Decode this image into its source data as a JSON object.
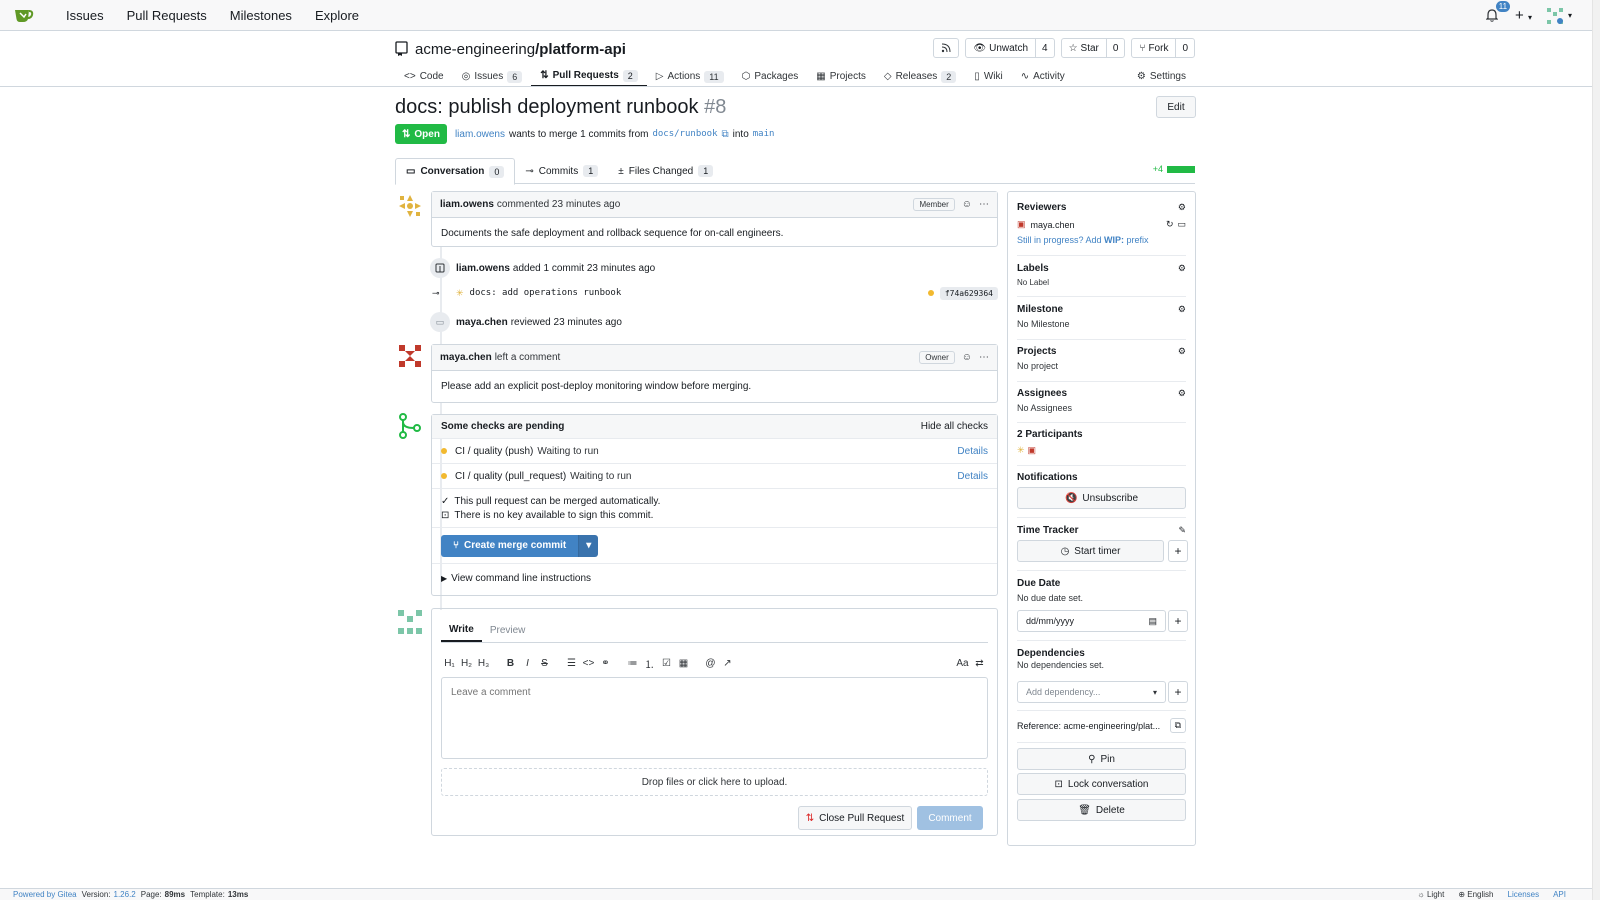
{
  "topnav": {
    "links": [
      "Issues",
      "Pull Requests",
      "Milestones",
      "Explore"
    ],
    "notification_count": "11"
  },
  "repo": {
    "owner": "acme-engineering",
    "separator": "/",
    "name": "platform-api",
    "watch": {
      "label": "Unwatch",
      "count": "4"
    },
    "star": {
      "label": "Star",
      "count": "0"
    },
    "fork": {
      "label": "Fork",
      "count": "0"
    },
    "tabs": [
      {
        "label": "Code",
        "count": null,
        "icon": "code-icon"
      },
      {
        "label": "Issues",
        "count": "6",
        "icon": "issue-icon"
      },
      {
        "label": "Pull Requests",
        "count": "2",
        "icon": "pull-request-icon",
        "active": true
      },
      {
        "label": "Actions",
        "count": "11",
        "icon": "play-icon"
      },
      {
        "label": "Packages",
        "count": null,
        "icon": "package-icon"
      },
      {
        "label": "Projects",
        "count": null,
        "icon": "project-icon"
      },
      {
        "label": "Releases",
        "count": "2",
        "icon": "tag-icon"
      },
      {
        "label": "Wiki",
        "count": null,
        "icon": "book-icon"
      },
      {
        "label": "Activity",
        "count": null,
        "icon": "pulse-icon"
      }
    ],
    "settings_label": "Settings"
  },
  "pr": {
    "title": "docs: publish deployment runbook",
    "number": "#8",
    "edit_label": "Edit",
    "status": "Open",
    "author": "liam.owens",
    "merge_text": "wants to merge 1 commits from",
    "head_branch": "docs/runbook",
    "into_text": "into",
    "base_branch": "main",
    "tabs": [
      {
        "label": "Conversation",
        "count": "0"
      },
      {
        "label": "Commits",
        "count": "1"
      },
      {
        "label": "Files Changed",
        "count": "1"
      }
    ],
    "diffstat": "+4"
  },
  "timeline": {
    "comment1": {
      "author": "liam.owens",
      "action": "commented 23 minutes ago",
      "role": "Member",
      "body": "Documents the safe deployment and rollback sequence for on-call engineers."
    },
    "commit_event": {
      "author": "liam.owens",
      "action": "added 1 commit 23 minutes ago",
      "message": "docs: add operations runbook",
      "sha": "f74a629364"
    },
    "review_event": {
      "author": "maya.chen",
      "action": "reviewed 23 minutes ago"
    },
    "comment2": {
      "author": "maya.chen",
      "action": "left a comment",
      "role": "Owner",
      "body": "Please add an explicit post-deploy monitoring window before merging."
    }
  },
  "merge": {
    "checks_title": "Some checks are pending",
    "hide_label": "Hide all checks",
    "checks": [
      {
        "name": "CI / quality (push)",
        "status": "Waiting to run",
        "link": "Details"
      },
      {
        "name": "CI / quality (pull_request)",
        "status": "Waiting to run",
        "link": "Details"
      }
    ],
    "auto_merge_text": "This pull request can be merged automatically.",
    "sign_text": "There is no key available to sign this commit.",
    "merge_button": "Create merge commit",
    "cmdline_label": "View command line instructions"
  },
  "comment_form": {
    "tab_write": "Write",
    "tab_preview": "Preview",
    "placeholder": "Leave a comment",
    "dropzone": "Drop files or click here to upload.",
    "close_button": "Close Pull Request",
    "comment_button": "Comment"
  },
  "sidebar": {
    "reviewers_title": "Reviewers",
    "reviewer": "maya.chen",
    "wip_text": "Still in progress? Add ",
    "wip_bold": "WIP:",
    "wip_suffix": " prefix",
    "labels_title": "Labels",
    "labels_value": "No Label",
    "milestone_title": "Milestone",
    "milestone_value": "No Milestone",
    "projects_title": "Projects",
    "projects_value": "No project",
    "assignees_title": "Assignees",
    "assignees_value": "No Assignees",
    "participants_title": "2 Participants",
    "notifications_title": "Notifications",
    "unsubscribe_label": "Unsubscribe",
    "time_tracker_title": "Time Tracker",
    "start_timer_label": "Start timer",
    "due_date_title": "Due Date",
    "due_date_value": "No due date set.",
    "date_placeholder": "dd/mm/yyyy",
    "dependencies_title": "Dependencies",
    "dependencies_value": "No dependencies set.",
    "add_dependency_placeholder": "Add dependency...",
    "reference_text": "Reference: acme-engineering/plat...",
    "pin_label": "Pin",
    "lock_label": "Lock conversation",
    "delete_label": "Delete"
  },
  "footer": {
    "powered": "Powered by Gitea",
    "version_label": "Version:",
    "version": "1.26.2",
    "page_label": "Page:",
    "page_time": "89ms",
    "template_label": "Template:",
    "template_time": "13ms",
    "theme": "Light",
    "language": "English",
    "licenses": "Licenses",
    "api": "API"
  },
  "colors": {
    "accent": "#4183c4",
    "open_green": "#21ba45",
    "pending_yellow": "#f2b92f",
    "close_red": "#db2828"
  }
}
